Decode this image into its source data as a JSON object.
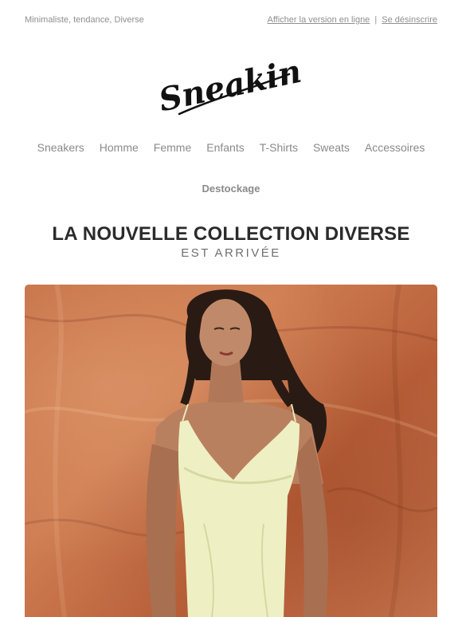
{
  "topbar": {
    "preheader": "Minimaliste, tendance, Diverse",
    "view_online": "Afficher la version en ligne",
    "separator": "|",
    "unsubscribe": "Se désinscrire"
  },
  "logo": {
    "text": "Sneakin"
  },
  "nav": {
    "items": [
      "Sneakers",
      "Homme",
      "Femme",
      "Enfants",
      "T-Shirts",
      "Sweats",
      "Accessoires"
    ],
    "secondary": "Destockage"
  },
  "hero_text": {
    "title": "LA NOUVELLE COLLECTION DIVERSE",
    "subtitle": "EST ARRIVÉE"
  },
  "colors": {
    "text": "#2b2b2b",
    "muted": "#8a8a8a",
    "hero_background": "#c46e44",
    "dress": "#eef0c4"
  }
}
